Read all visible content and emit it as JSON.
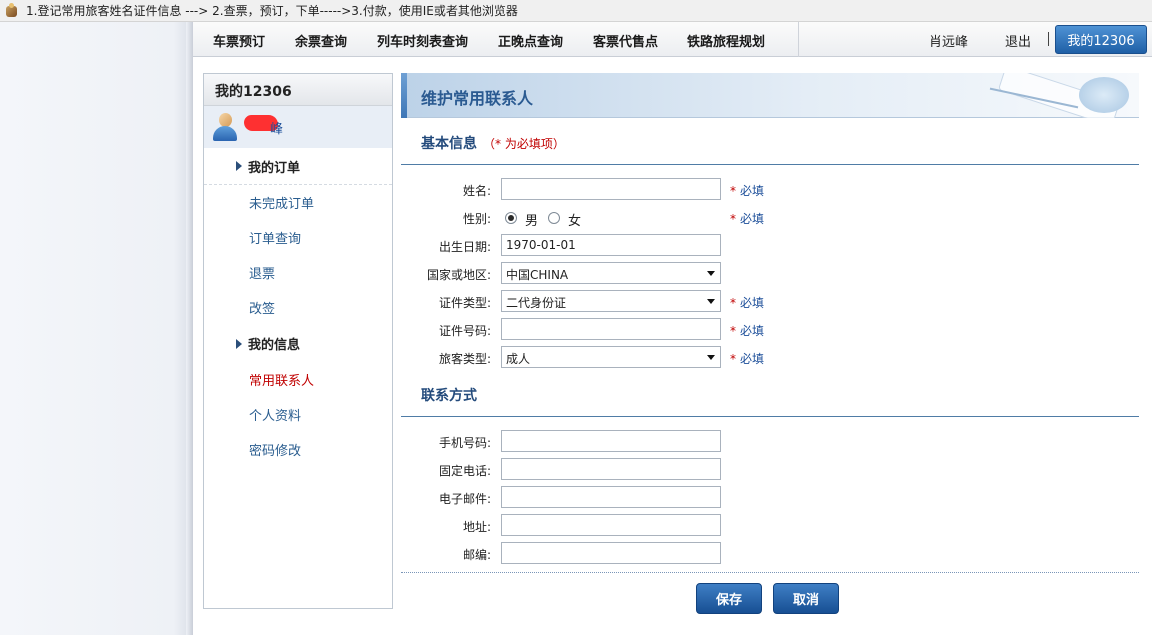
{
  "notice": {
    "text": "1.登记常用旅客姓名证件信息 ---> 2.查票，预订，下单----->3.付款，使用IE或者其他浏览器"
  },
  "nav": {
    "items": [
      "车票预订",
      "余票查询",
      "列车时刻表查询",
      "正晚点查询",
      "客票代售点",
      "铁路旅程规划"
    ],
    "user_name": "肖远峰",
    "logout": "退出",
    "my12306": "我的12306"
  },
  "sidebar": {
    "title": "我的12306",
    "username": "峰",
    "groups": [
      {
        "label": "我的订单",
        "links": [
          "未完成订单",
          "订单查询",
          "退票",
          "改签"
        ]
      },
      {
        "label": "我的信息",
        "links": [
          "常用联系人",
          "个人资料",
          "密码修改"
        ]
      }
    ],
    "active_link": "常用联系人"
  },
  "content": {
    "title": "维护常用联系人",
    "basic": {
      "title": "基本信息",
      "required_note": "（* 为必填项）",
      "name_label": "姓名:",
      "gender_label": "性别:",
      "gender_male": "男",
      "gender_female": "女",
      "gender_selected": "男",
      "birth_label": "出生日期:",
      "birth_value": "1970-01-01",
      "country_label": "国家或地区:",
      "country_value": "中国CHINA",
      "id_type_label": "证件类型:",
      "id_type_value": "二代身份证",
      "id_no_label": "证件号码:",
      "passenger_type_label": "旅客类型:",
      "passenger_type_value": "成人",
      "required_star": "*",
      "required_text": "必填"
    },
    "contact": {
      "title": "联系方式",
      "mobile_label": "手机号码:",
      "phone_label": "固定电话:",
      "email_label": "电子邮件:",
      "address_label": "地址:",
      "postcode_label": "邮编:"
    },
    "buttons": {
      "save": "保存",
      "cancel": "取消"
    }
  }
}
